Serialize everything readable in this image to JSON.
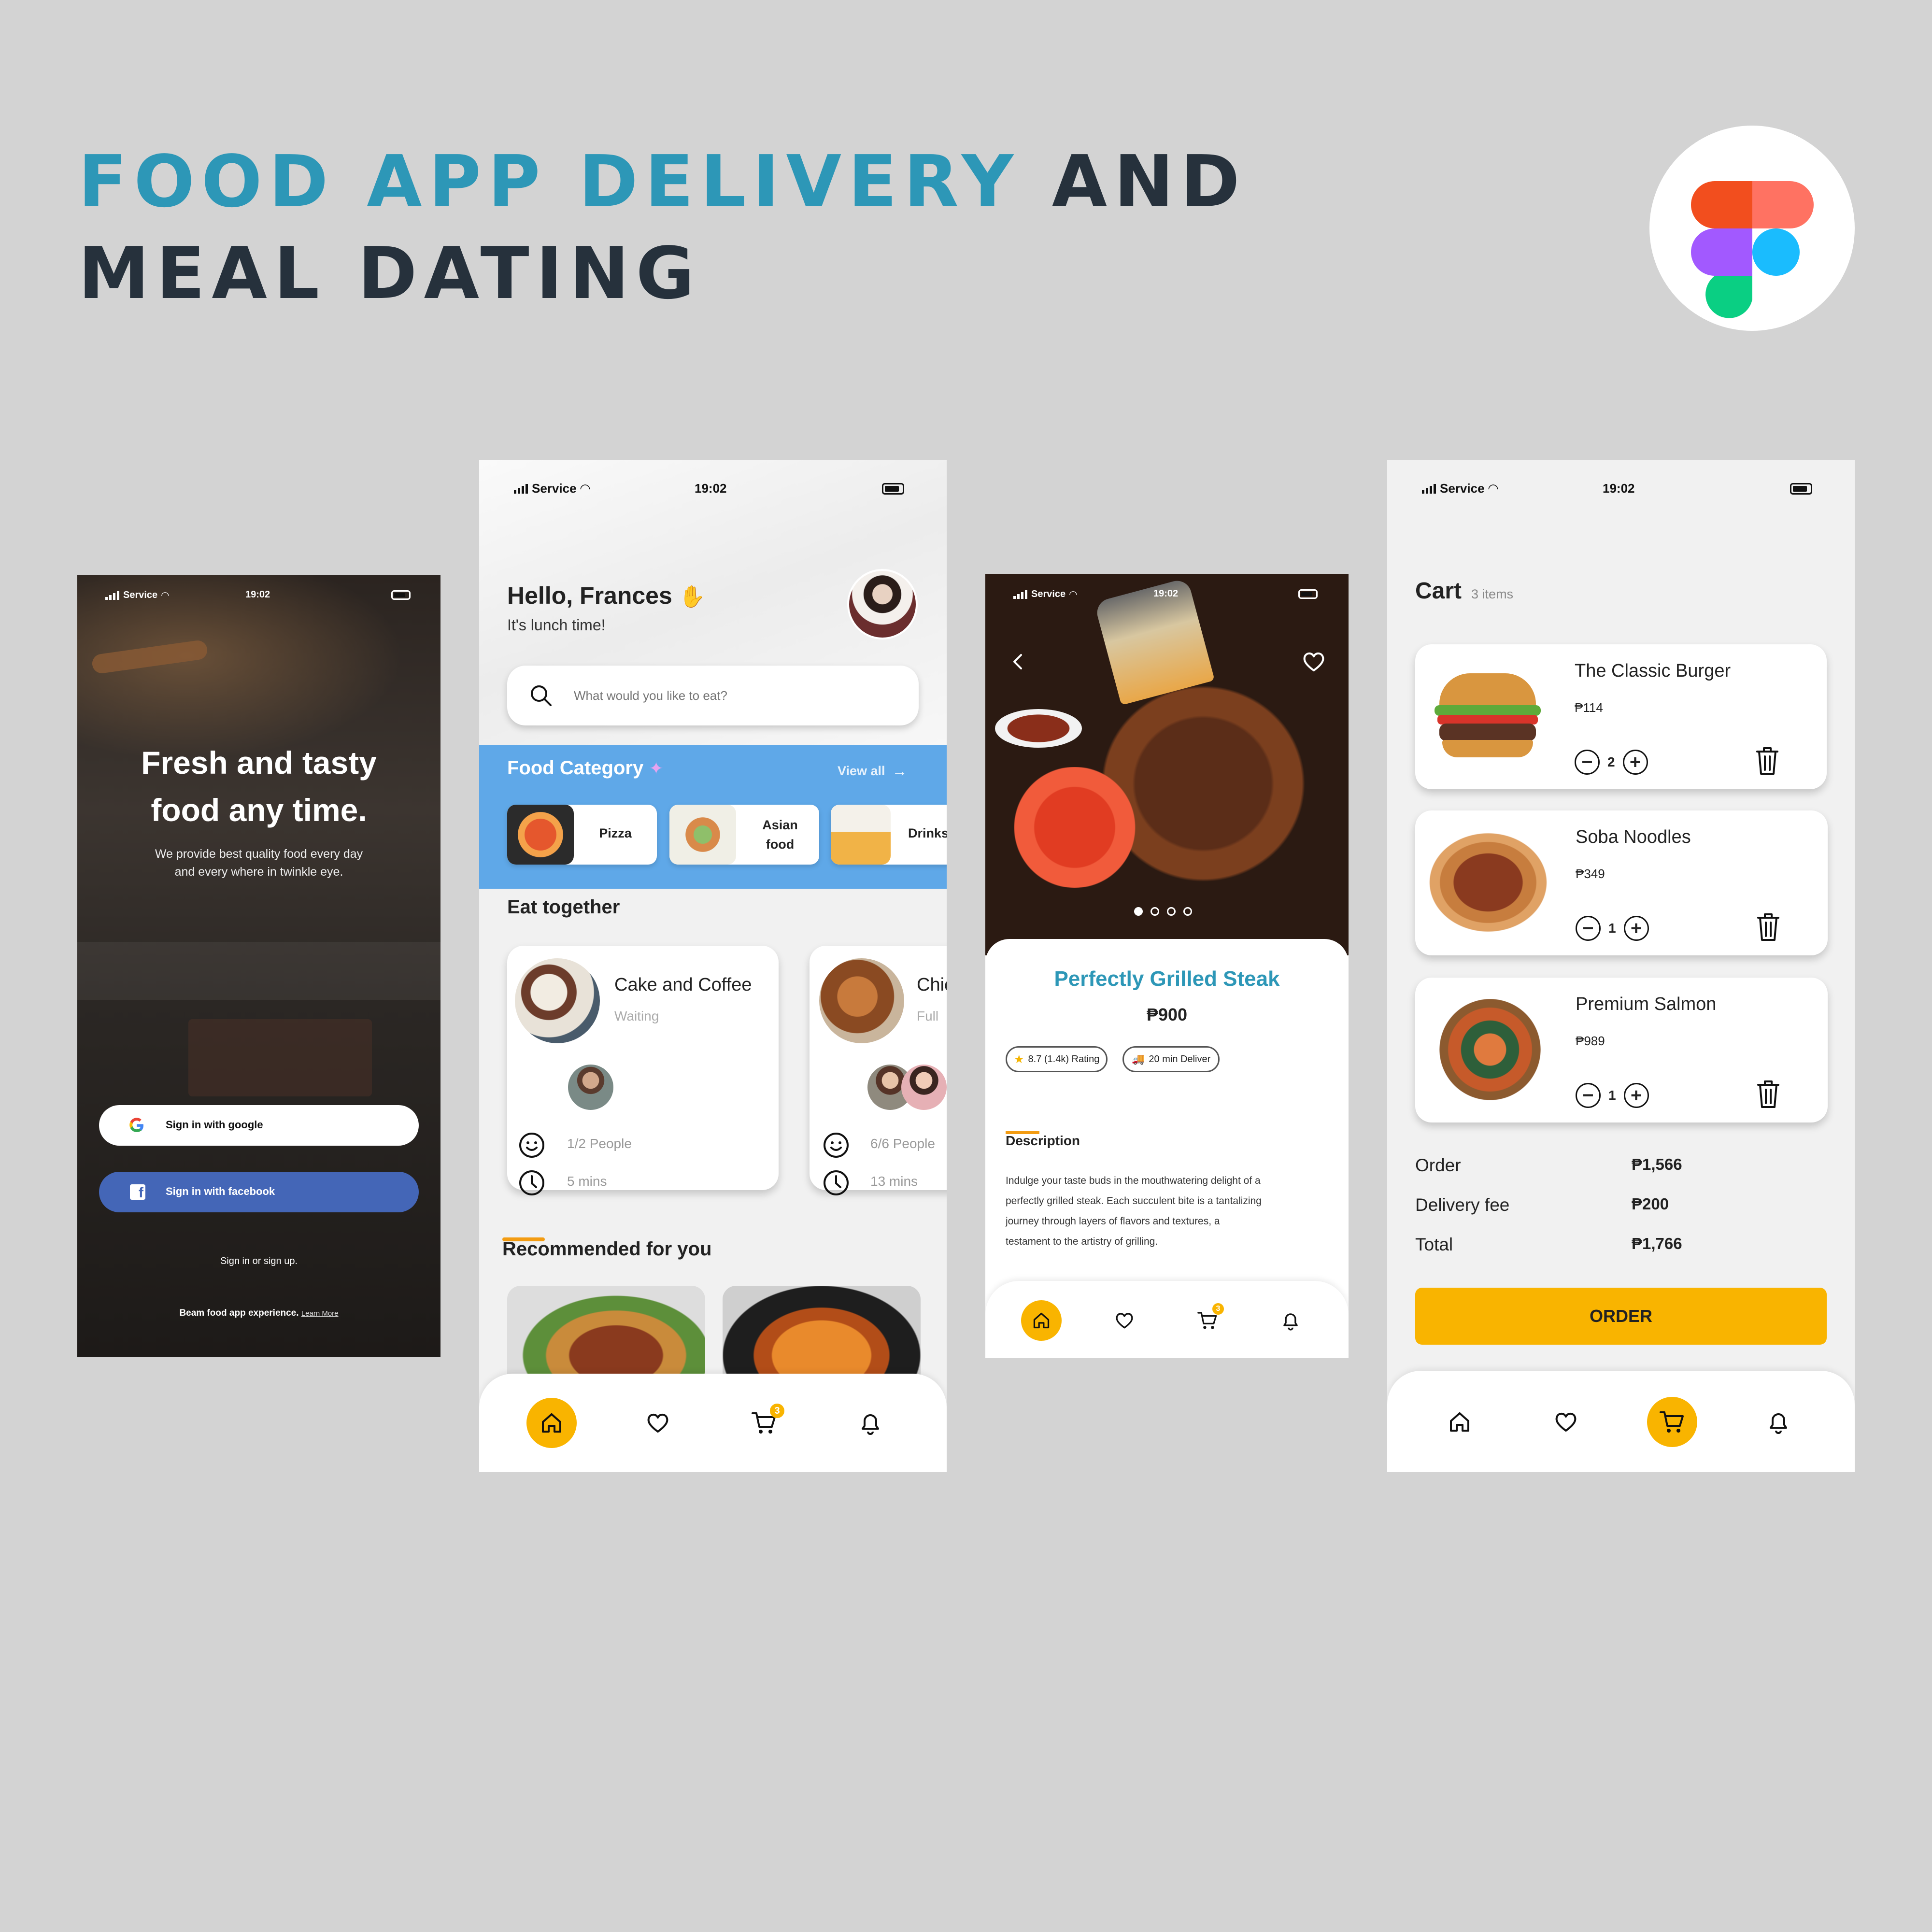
{
  "header": {
    "title_blue": "FOOD APP DELIVERY",
    "title_dark_1": "AND",
    "title_dark_2": "MEAL DATING"
  },
  "status": {
    "service": "Service",
    "time": "19:02"
  },
  "login": {
    "headline_1": "Fresh and tasty",
    "headline_2": "food any time.",
    "sub_1": "We provide best quality food every day",
    "sub_2": "and every where in twinkle eye.",
    "google_label": "Sign in with google",
    "facebook_label": "Sign in with facebook",
    "signin_text": "Sign in or sign up.",
    "footer_text": "Beam food app experience.",
    "learn_more": "Learn More"
  },
  "home": {
    "greeting": "Hello, Frances",
    "subtitle": "It's lunch time!",
    "search_placeholder": "What would you like to eat?",
    "category_title": "Food Category",
    "view_all": "View all",
    "categories": [
      {
        "label": "Pizza"
      },
      {
        "label": "Asian food"
      },
      {
        "label": "Drinks"
      }
    ],
    "eat_together_title": "Eat together",
    "eat_cards": [
      {
        "title": "Cake and Coffee",
        "status": "Waiting",
        "people": "1/2 People",
        "time": "5 mins"
      },
      {
        "title": "Chicken",
        "status": "Full",
        "people": "6/6 People",
        "time": "13 mins"
      }
    ],
    "recommended_title": "Recommended for you",
    "cart_count": "3"
  },
  "detail": {
    "title": "Perfectly Grilled Steak",
    "price": "₱900",
    "rating": "8.7 (1.4k) Rating",
    "delivery": "20 min Deliver",
    "desc_title": "Description",
    "desc_lines": [
      "Indulge your taste buds in the mouthwatering delight of a",
      "perfectly grilled steak. Each succulent bite is a tantalizing",
      "journey through layers of flavors and textures, a",
      "testament to the artistry of grilling."
    ],
    "cart_count": "3"
  },
  "cart": {
    "title": "Cart",
    "count_label": "3 items",
    "items": [
      {
        "name": "The Classic Burger",
        "price": "₱114",
        "qty": "2"
      },
      {
        "name": "Soba Noodles",
        "price": "₱349",
        "qty": "1"
      },
      {
        "name": "Premium Salmon",
        "price": "₱989",
        "qty": "1"
      }
    ],
    "summary": {
      "order_label": "Order",
      "order_value": "₱1,566",
      "delivery_label": "Delivery fee",
      "delivery_value": "₱200",
      "total_label": "Total",
      "total_value": "₱1,766"
    },
    "order_button": "ORDER"
  },
  "colors": {
    "accent_yellow": "#f9b400",
    "title_blue": "#2d97b7",
    "category_blue": "#5fa8e8",
    "facebook_blue": "#4466b7"
  },
  "icons": [
    "home-icon",
    "heart-icon",
    "cart-icon",
    "bell-icon",
    "search-icon",
    "trash-icon",
    "back-icon",
    "google-icon",
    "facebook-icon",
    "star-icon",
    "smile-icon",
    "clock-icon",
    "arrow-right-icon",
    "figma-logo"
  ]
}
